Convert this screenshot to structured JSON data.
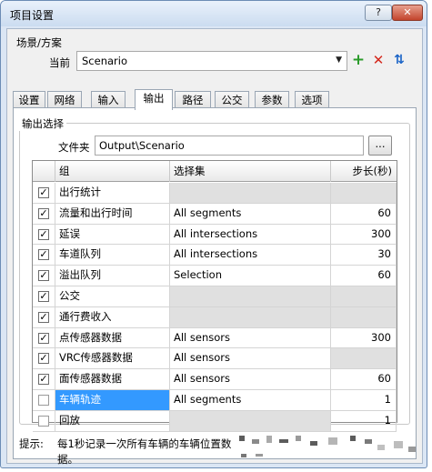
{
  "window": {
    "title": "项目设置",
    "help_label": "?",
    "close_label": "✕"
  },
  "scenario": {
    "section_label": "场景/方案",
    "current_label": "当前",
    "current_value": "Scenario",
    "dropdown_arrow": "▼",
    "add_label": "+",
    "delete_label": "✕",
    "swap_label": "⇅"
  },
  "tabs": [
    {
      "label": "设置",
      "active": false
    },
    {
      "label": "网络",
      "active": false
    },
    {
      "label": "输入",
      "active": false
    },
    {
      "label": "输出",
      "active": true
    },
    {
      "label": "路径",
      "active": false
    },
    {
      "label": "公交",
      "active": false
    },
    {
      "label": "参数",
      "active": false
    },
    {
      "label": "选项",
      "active": false
    }
  ],
  "output": {
    "group_title": "输出选择",
    "folder_label": "文件夹",
    "folder_value": "Output\\Scenario",
    "browse_label": "...",
    "columns": {
      "name": "组",
      "set": "选择集",
      "step": "步长(秒)"
    },
    "rows": [
      {
        "checked": true,
        "name": "出行统计",
        "set": "",
        "step": ""
      },
      {
        "checked": true,
        "name": "流量和出行时间",
        "set": "All segments",
        "step": "60"
      },
      {
        "checked": true,
        "name": "延误",
        "set": "All intersections",
        "step": "300"
      },
      {
        "checked": true,
        "name": "车道队列",
        "set": "All intersections",
        "step": "30"
      },
      {
        "checked": true,
        "name": "溢出队列",
        "set": "Selection",
        "step": "60"
      },
      {
        "checked": true,
        "name": "公交",
        "set": "",
        "step": ""
      },
      {
        "checked": true,
        "name": "通行费收入",
        "set": "",
        "step": ""
      },
      {
        "checked": true,
        "name": "点传感器数据",
        "set": "All sensors",
        "step": "300"
      },
      {
        "checked": true,
        "name": "VRC传感器数据",
        "set": "All sensors",
        "step": ""
      },
      {
        "checked": true,
        "name": "面传感器数据",
        "set": "All sensors",
        "step": "60"
      },
      {
        "checked": false,
        "name": "车辆轨迹",
        "set": "All segments",
        "step": "1"
      },
      {
        "checked": false,
        "name": "回放",
        "set": "",
        "step": "1"
      }
    ]
  },
  "hint": {
    "label": "提示:",
    "text": "每1秒记录一次所有车辆的车辆位置数据。"
  },
  "colors": {
    "selection": "#3399ff",
    "disabled_cell": "#e0e0e0",
    "add": "#2a9b2a",
    "delete": "#d4281d",
    "swap": "#1b64c7"
  }
}
